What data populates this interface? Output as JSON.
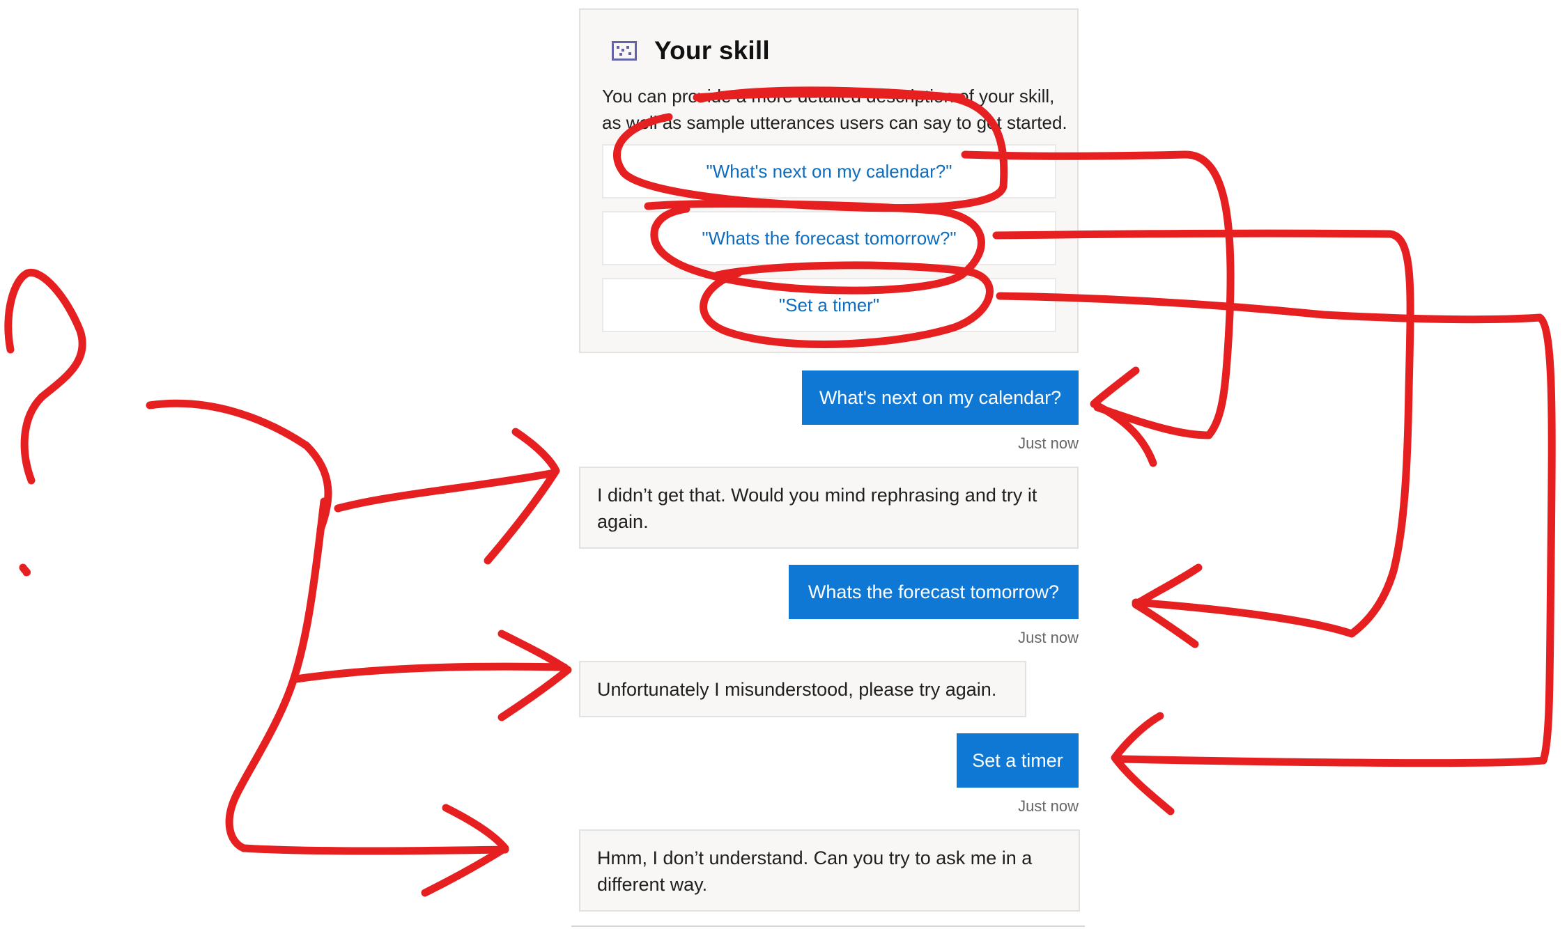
{
  "card": {
    "icon": "skill-icon",
    "title": "Your skill",
    "description": "You can provide a more detailed description of your skill, as well as sample utterances users can say to get started.",
    "suggestions": [
      "\"What's next on my calendar?\"",
      "\"Whats the forecast tomorrow?\"",
      "\"Set a timer\""
    ]
  },
  "conversation": {
    "messages": [
      {
        "from": "user",
        "text": "What's next on my calendar?",
        "timestamp": "Just now"
      },
      {
        "from": "bot",
        "text": "I didn’t get that. Would you mind rephrasing and try it again."
      },
      {
        "from": "user",
        "text": "Whats the forecast tomorrow?",
        "timestamp": "Just now"
      },
      {
        "from": "bot",
        "text": "Unfortunately I misunderstood, please try again."
      },
      {
        "from": "user",
        "text": "Set a timer",
        "timestamp": "Just now"
      },
      {
        "from": "bot",
        "text": "Hmm, I don’t understand. Can you try to ask me in a different way."
      }
    ]
  },
  "colors": {
    "user_bubble": "#0f78d4",
    "link_text": "#0f6cbd",
    "annotation_ink": "#e62020"
  }
}
